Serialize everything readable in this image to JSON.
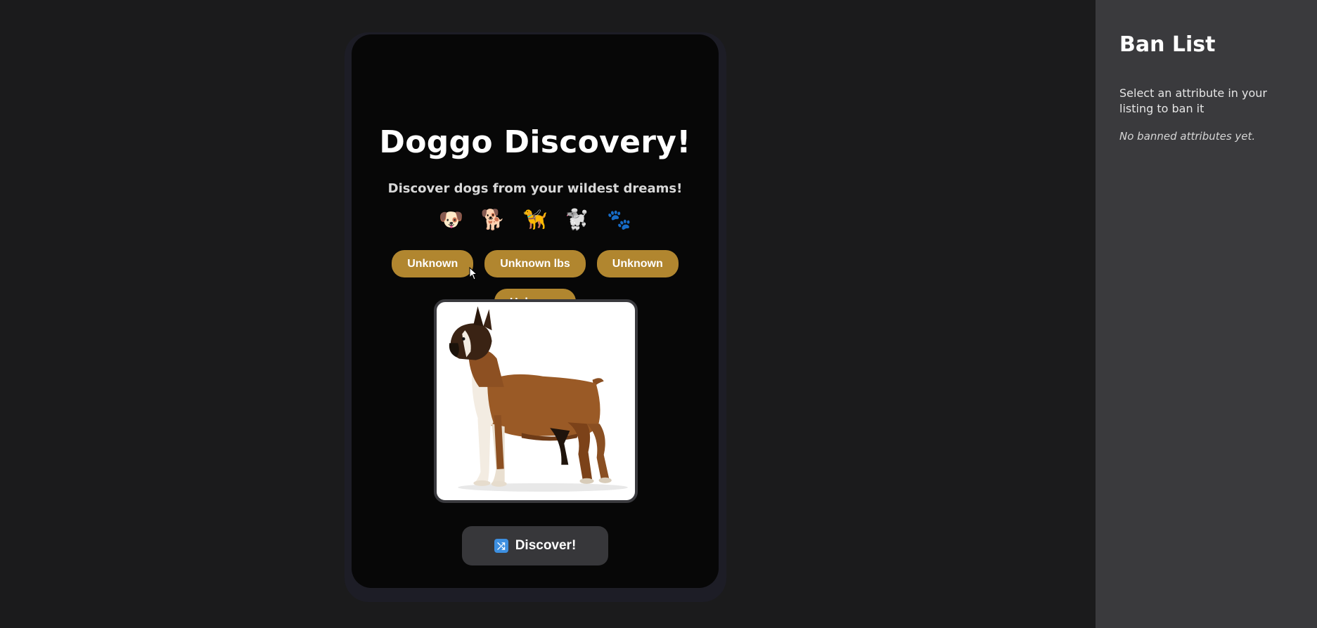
{
  "app": {
    "title": "Doggo Discovery!",
    "subtitle": "Discover dogs from your wildest dreams!",
    "emojis": [
      "🐶",
      "🐕",
      "🦮",
      "🐩",
      "🐾"
    ]
  },
  "attributes": [
    {
      "label": "Unknown"
    },
    {
      "label": "Unknown lbs"
    },
    {
      "label": "Unknown"
    },
    {
      "label": "Unknown"
    }
  ],
  "discover_button": {
    "label": "Discover!",
    "icon": "shuffle-icon"
  },
  "ban_list": {
    "title": "Ban List",
    "help_text": "Select an attribute in your listing to ban it",
    "empty_text": "No banned attributes yet."
  },
  "colors": {
    "background": "#1b1b1c",
    "card": "#070707",
    "attribute_button": "#b1862f",
    "discover_button": "#37373a",
    "sidebar": "#3a3a3d"
  }
}
